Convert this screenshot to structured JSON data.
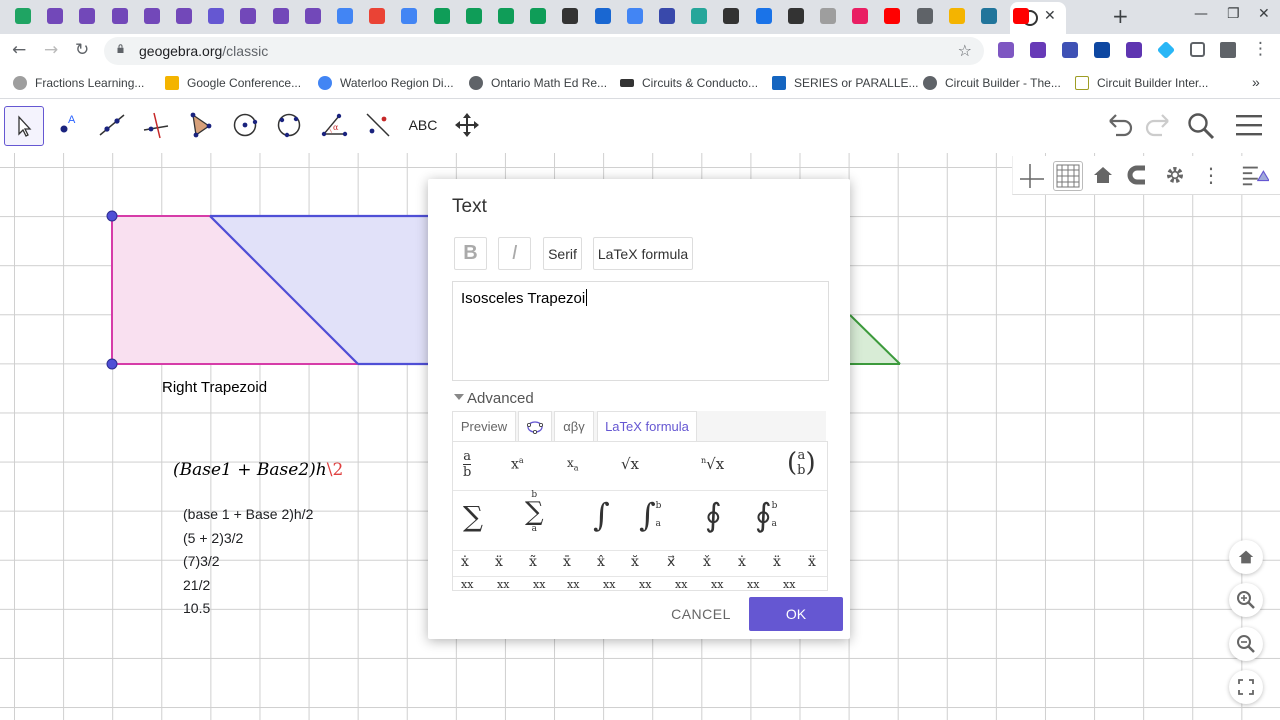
{
  "browser": {
    "tabs": [
      {
        "icon": "google-drive-icon",
        "color": "#1fa463"
      },
      {
        "icon": "google-forms-icon",
        "color": "#7248b9"
      },
      {
        "icon": "google-forms-icon",
        "color": "#7248b9"
      },
      {
        "icon": "google-forms-icon",
        "color": "#7248b9"
      },
      {
        "icon": "google-forms-icon",
        "color": "#7248b9"
      },
      {
        "icon": "google-forms-icon",
        "color": "#7248b9"
      },
      {
        "icon": "google-slides-icon",
        "color": "#6557d2"
      },
      {
        "icon": "google-forms-icon",
        "color": "#7248b9"
      },
      {
        "icon": "google-forms-icon",
        "color": "#7248b9"
      },
      {
        "icon": "google-forms-icon",
        "color": "#7248b9"
      },
      {
        "icon": "google-docs-icon",
        "color": "#4285f4"
      },
      {
        "icon": "gmail-icon",
        "color": "#ea4335"
      },
      {
        "icon": "google-docs-icon",
        "color": "#4285f4"
      },
      {
        "icon": "google-sheets-icon",
        "color": "#0f9d58"
      },
      {
        "icon": "google-sheets-icon",
        "color": "#0f9d58"
      },
      {
        "icon": "google-sheets-icon",
        "color": "#0f9d58"
      },
      {
        "icon": "google-sheets-icon",
        "color": "#0f9d58"
      },
      {
        "icon": "clock-icon",
        "color": "#333333"
      },
      {
        "icon": "people-icon",
        "color": "#1967d2"
      },
      {
        "icon": "google-docs-icon",
        "color": "#4285f4"
      },
      {
        "icon": "up-icon",
        "color": "#3949ab"
      },
      {
        "icon": "chat-icon",
        "color": "#26a69a"
      },
      {
        "icon": "classroom-icon",
        "color": "#333333"
      },
      {
        "icon": "account-icon",
        "color": "#1a73e8"
      },
      {
        "icon": "classroom-icon",
        "color": "#333333"
      },
      {
        "icon": "news-icon",
        "color": "#9e9e9e"
      },
      {
        "icon": "app-icon",
        "color": "#e91e63"
      },
      {
        "icon": "youtube-icon",
        "color": "#ff0000"
      },
      {
        "icon": "globe-icon",
        "color": "#5f6368"
      },
      {
        "icon": "lightbulb-icon",
        "color": "#f4b400"
      },
      {
        "icon": "wordpress-icon",
        "color": "#21759b"
      },
      {
        "icon": "youtube-icon",
        "color": "#ff0000"
      }
    ],
    "active_tab_icon": "geogebra-icon",
    "close_glyph": "✕",
    "new_tab_glyph": "+",
    "url_host": "geogebra.org",
    "url_path": "/classic",
    "bookmarks": [
      {
        "label": "Fractions Learning...",
        "color": "#888888"
      },
      {
        "label": "Google Conference...",
        "color": "#f4b400"
      },
      {
        "label": "Waterloo Region Di...",
        "color": "#4285f4"
      },
      {
        "label": "Ontario Math Ed Re...",
        "color": "#5f6368"
      },
      {
        "label": "Circuits & Conducto...",
        "color": "#333333"
      },
      {
        "label": "SERIES or PARALLE...",
        "color": "#1565c0"
      },
      {
        "label": "Circuit Builder - The...",
        "color": "#5f6368"
      },
      {
        "label": "Circuit Builder Inter...",
        "color": "#9e9d24"
      }
    ],
    "bookmarks_more": "»"
  },
  "geogebra": {
    "tools": [
      "move-tool",
      "point-tool",
      "line-tool",
      "perpendicular-tool",
      "polygon-tool",
      "circle-tool",
      "conic-tool",
      "angle-tool",
      "reflect-tool",
      "text-tool",
      "move-graphics-tool"
    ],
    "text_tool_label": "ABC",
    "labels": {
      "right_trapezoid": "Right Trapezoid"
    },
    "formula": {
      "main": "(Base1 + Base2)h",
      "red": "\\2"
    },
    "calc_lines": [
      "(base 1 + Base 2)h/2",
      "(5 + 2)3/2",
      "(7)3/2",
      "21/2",
      "10.5"
    ],
    "colors": {
      "accent": "#6557d2",
      "pink_fill": "#f9e0f0",
      "pink_stroke": "#d63ca8",
      "blue_fill": "#e1e1f9",
      "blue_stroke": "#4f4fd6",
      "green_fill": "#d8ecd6",
      "green_stroke": "#3c9a3c"
    }
  },
  "dialog": {
    "title": "Text",
    "bold": "B",
    "italic": "I",
    "serif": "Serif",
    "latex": "LaTeX formula",
    "text_value": "Isosceles Trapezoi",
    "advanced": "Advanced",
    "tabs": [
      "Preview",
      "αβγ",
      "LaTeX formula"
    ],
    "tab_icon": "geogebra-objects-icon",
    "symbols_row1": [
      "a/b",
      "xᵃ",
      "xₐ",
      "√x",
      "ⁿ√x",
      "(a b)"
    ],
    "symbols_row2": [
      "∑",
      "∑ᵃᵇ",
      "∫",
      "∫ₐᵇ",
      "∮",
      "∮ₐᵇ"
    ],
    "symbols_row3": [
      "ẋ",
      "ẍ",
      "x̃",
      "x̄",
      "x̂",
      "x̆",
      "x⃗",
      "x̌",
      "ẋ",
      "ẍ",
      "ẍ"
    ],
    "symbols_row4": [
      "xx",
      "xx",
      "xx",
      "xx",
      "xx",
      "xx",
      "xx",
      "xx",
      "xx",
      "xx"
    ],
    "cancel": "CANCEL",
    "ok": "OK"
  }
}
